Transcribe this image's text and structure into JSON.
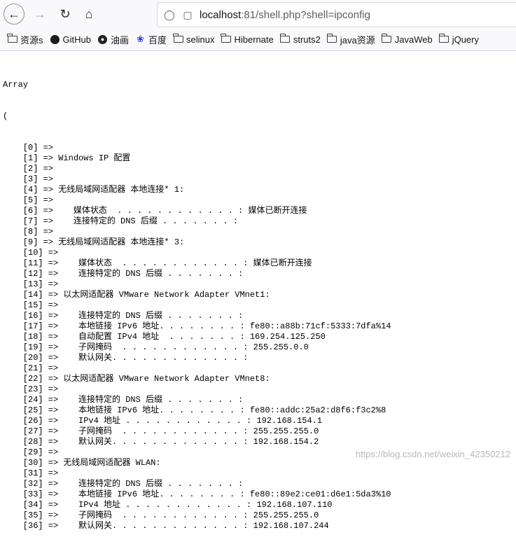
{
  "browser": {
    "nav": {
      "back_icon": "arrow-left-icon",
      "forward_icon": "arrow-right-icon",
      "reload_icon": "reload-icon",
      "home_icon": "home-icon"
    },
    "url": {
      "host": "localhost",
      "rest": ":81/shell.php?shell=ipconfig"
    },
    "bookmarks": [
      {
        "label": "资源s",
        "icon": "folder-icon"
      },
      {
        "label": "GitHub",
        "icon": "github-icon"
      },
      {
        "label": "油画",
        "icon": "oil-painting-icon"
      },
      {
        "label": "百度",
        "icon": "baidu-paw-icon"
      },
      {
        "label": "selinux",
        "icon": "folder-icon"
      },
      {
        "label": "Hibernate",
        "icon": "folder-icon"
      },
      {
        "label": "struts2",
        "icon": "folder-icon"
      },
      {
        "label": "java资源",
        "icon": "folder-icon"
      },
      {
        "label": "JavaWeb",
        "icon": "folder-icon"
      },
      {
        "label": "jQuery",
        "icon": "folder-icon"
      }
    ]
  },
  "page": {
    "header": "Array",
    "open_paren": "(",
    "lines": [
      "    [0] => ",
      "    [1] => Windows IP 配置",
      "    [2] => ",
      "    [3] => ",
      "    [4] => 无线局域网适配器 本地连接* 1:",
      "    [5] => ",
      "    [6] =>    媒体状态  . . . . . . . . . . . . : 媒体已断开连接",
      "    [7] =>    连接特定的 DNS 后缀 . . . . . . . : ",
      "    [8] => ",
      "    [9] => 无线局域网适配器 本地连接* 3:",
      "    [10] => ",
      "    [11] =>    媒体状态  . . . . . . . . . . . . : 媒体已断开连接",
      "    [12] =>    连接特定的 DNS 后缀 . . . . . . . : ",
      "    [13] => ",
      "    [14] => 以太网适配器 VMware Network Adapter VMnet1:",
      "    [15] => ",
      "    [16] =>    连接特定的 DNS 后缀 . . . . . . . : ",
      "    [17] =>    本地链接 IPv6 地址. . . . . . . . : fe80::a88b:71cf:5333:7dfa%14",
      "    [18] =>    自动配置 IPv4 地址  . . . . . . . : 169.254.125.250",
      "    [19] =>    子网掩码  . . . . . . . . . . . . : 255.255.0.0",
      "    [20] =>    默认网关. . . . . . . . . . . . . : ",
      "    [21] => ",
      "    [22] => 以太网适配器 VMware Network Adapter VMnet8:",
      "    [23] => ",
      "    [24] =>    连接特定的 DNS 后缀 . . . . . . . : ",
      "    [25] =>    本地链接 IPv6 地址. . . . . . . . : fe80::addc:25a2:d8f6:f3c2%8",
      "    [26] =>    IPv4 地址 . . . . . . . . . . . . : 192.168.154.1",
      "    [27] =>    子网掩码  . . . . . . . . . . . . : 255.255.255.0",
      "    [28] =>    默认网关. . . . . . . . . . . . . : 192.168.154.2",
      "    [29] => ",
      "    [30] => 无线局域网适配器 WLAN:",
      "    [31] => ",
      "    [32] =>    连接特定的 DNS 后缀 . . . . . . . : ",
      "    [33] =>    本地链接 IPv6 地址. . . . . . . . : fe80::89e2:ce01:d6e1:5da3%10",
      "    [34] =>    IPv4 地址 . . . . . . . . . . . . : 192.168.107.110",
      "    [35] =>    子网掩码  . . . . . . . . . . . . : 255.255.255.0",
      "    [36] =>    默认网关. . . . . . . . . . . . . : 192.168.107.244"
    ]
  },
  "watermark": "https://blog.csdn.net/weixin_42350212"
}
